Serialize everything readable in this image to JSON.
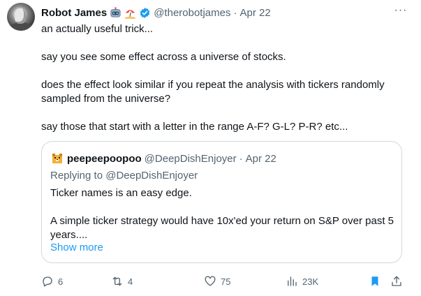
{
  "tweet": {
    "author_name": "Robot James",
    "author_emojis": [
      "robot-emoji",
      "beach-umbrella-emoji"
    ],
    "verified": true,
    "handle": "@therobotjames",
    "separator": "·",
    "date": "Apr 22",
    "more_label": "···",
    "paragraphs": [
      "an actually useful trick...",
      "say you see some effect across a universe of stocks.",
      "does the effect look similar if you repeat the analysis with tickers randomly sampled from the universe?",
      "say those that start with a letter in the range A-F? G-L? P-R? etc..."
    ]
  },
  "quote": {
    "author_name": "peepeepoopoo",
    "handle": "@DeepDishEnjoyer",
    "separator": "·",
    "date": "Apr 22",
    "replying_prefix": "Replying to",
    "replying_to": "@DeepDishEnjoyer",
    "paragraphs": [
      "Ticker names is an easy edge.",
      "A simple ticker strategy would have 10x'ed your return on S&P over past 5 years...."
    ],
    "show_more": "Show more"
  },
  "actions": {
    "replies": "6",
    "retweets": "4",
    "likes": "75",
    "views": "23K"
  },
  "colors": {
    "text": "#0f1419",
    "secondary": "#536471",
    "accent": "#1d9bf0",
    "border": "#cfd9de"
  }
}
